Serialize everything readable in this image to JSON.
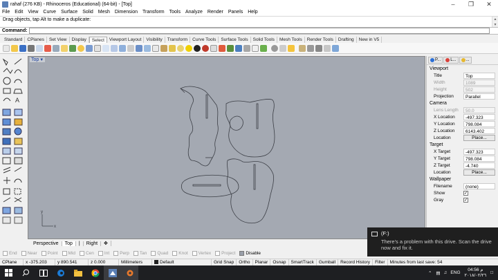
{
  "window": {
    "title": "rahaf (276 KB) - Rhinoceros (Educational) (64-bit) - [Top]"
  },
  "menu": [
    "File",
    "Edit",
    "View",
    "Curve",
    "Surface",
    "Solid",
    "Mesh",
    "Dimension",
    "Transform",
    "Tools",
    "Analyze",
    "Render",
    "Panels",
    "Help"
  ],
  "history": {
    "line": "Drag objects, tap Alt to make a duplicate:"
  },
  "command": {
    "label": "Command:",
    "value": ""
  },
  "toolbar_tabs": [
    "Standard",
    "CPlanes",
    "Set View",
    "Display",
    "Select",
    "Viewport Layout",
    "Visibility",
    "Transform",
    "Curve Tools",
    "Surface Tools",
    "Solid Tools",
    "Mesh Tools",
    "Render Tools",
    "Drafting",
    "New in V5"
  ],
  "toolbar_tabs_active": "Select",
  "viewport": {
    "name": "Top",
    "arrow": "▼"
  },
  "viewport_tabs": [
    "Perspective",
    "Top",
    "|",
    "Right",
    "✥"
  ],
  "panel": {
    "tabs": [
      {
        "label": "P...",
        "color": "#2b6fd6"
      },
      {
        "label": "L...",
        "color": "#d9413a"
      },
      {
        "label": "...",
        "color": "#e6b830"
      }
    ],
    "viewport_section": "Viewport",
    "viewport_rows": [
      {
        "k": "Title",
        "v": "Top",
        "dim": false
      },
      {
        "k": "Width",
        "v": "1089",
        "dim": true
      },
      {
        "k": "Height",
        "v": "502",
        "dim": true
      },
      {
        "k": "Projection",
        "v": "Parallel",
        "dim": false
      }
    ],
    "camera_section": "Camera",
    "camera_rows": [
      {
        "k": "Lens Length",
        "v": "50.0",
        "dim": true
      },
      {
        "k": "X Location",
        "v": "-497.323",
        "dim": false
      },
      {
        "k": "Y Location",
        "v": "798.084",
        "dim": false
      },
      {
        "k": "Z Location",
        "v": "6143.402",
        "dim": false
      }
    ],
    "camera_location": {
      "k": "Location",
      "btn": "Place..."
    },
    "target_section": "Target",
    "target_rows": [
      {
        "k": "X Target",
        "v": "-497.323"
      },
      {
        "k": "Y Target",
        "v": "798.084"
      },
      {
        "k": "Z Target",
        "v": "-4.740"
      }
    ],
    "target_location": {
      "k": "Location",
      "btn": "Place..."
    },
    "wallpaper_section": "Wallpaper",
    "wallpaper_filename": {
      "k": "Filename",
      "v": "(none)"
    },
    "wallpaper_show": {
      "k": "Show",
      "checked": "✓"
    },
    "wallpaper_gray": {
      "k": "Gray",
      "checked": "✓"
    }
  },
  "osnap": [
    {
      "label": "End",
      "on": false
    },
    {
      "label": "Near",
      "on": false
    },
    {
      "label": "Point",
      "on": false
    },
    {
      "label": "Mid",
      "on": false
    },
    {
      "label": "Cen",
      "on": false
    },
    {
      "label": "Int",
      "on": false
    },
    {
      "label": "Perp",
      "on": false
    },
    {
      "label": "Tan",
      "on": false
    },
    {
      "label": "Quad",
      "on": false
    },
    {
      "label": "Knot",
      "on": false
    },
    {
      "label": "Vertex",
      "on": false
    },
    {
      "label": "Project",
      "on": false
    },
    {
      "label": "Disable",
      "on": true
    }
  ],
  "status": {
    "cplane": "CPlane",
    "x": "x -375.203",
    "y": "y 890.541",
    "z": "z 0.000",
    "units": "Millimeters",
    "layer": "Default",
    "grid_snap": "Grid Snap",
    "ortho": "Ortho",
    "planar": "Planar",
    "osnap": "Osnap",
    "smarttrack": "SmartTrack",
    "gumball": "Gumball",
    "record_history": "Record History",
    "filter": "Filter",
    "save_msg": "Minutes from last save: 54"
  },
  "toast": {
    "title": "(F:)",
    "body": "There's a problem with this drive.  Scan the drive now and fix it."
  },
  "tray": {
    "lang": "ENG",
    "time": "04:56 م",
    "date": "٢٠١٨/٠٢/٢٦"
  },
  "colors": {
    "viewport_bg": "#a4a9b2",
    "curve": "#3b3e45",
    "taskbar": "#1e1f22"
  }
}
